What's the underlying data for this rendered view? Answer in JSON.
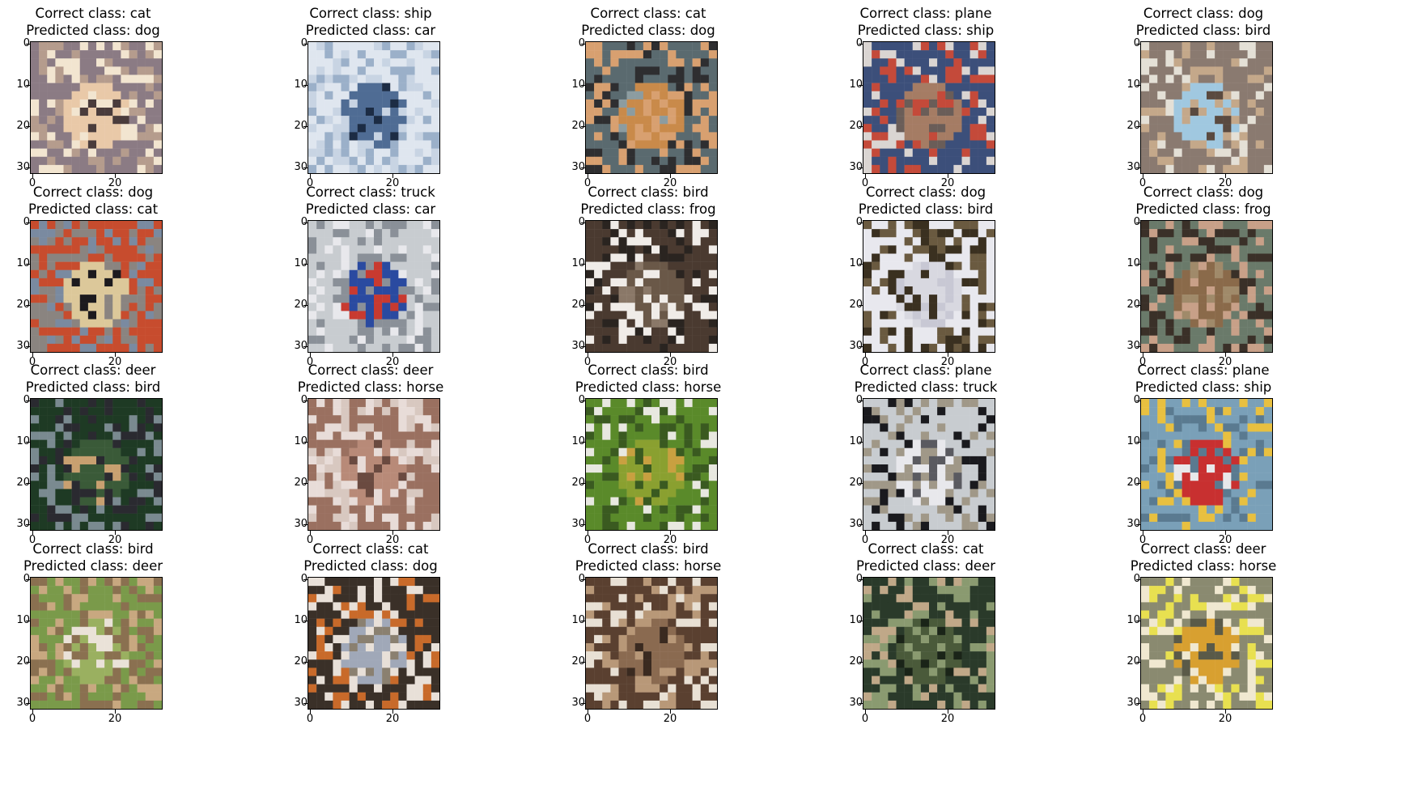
{
  "figure": {
    "panels": [
      {
        "correct": "Correct class: cat",
        "predicted": "Predicted class: dog",
        "image_subject": "cat",
        "palette": [
          "#8b7b84",
          "#e9c9a8",
          "#b59c8d",
          "#4a3c3c",
          "#f2e5d0"
        ]
      },
      {
        "correct": "Correct class: ship",
        "predicted": "Predicted class: car",
        "image_subject": "ship",
        "palette": [
          "#dfe6ef",
          "#4f6c94",
          "#9bb0c9",
          "#1c2c44",
          "#c8d4e3"
        ]
      },
      {
        "correct": "Correct class: cat",
        "predicted": "Predicted class: dog",
        "image_subject": "cat",
        "palette": [
          "#5a6a6f",
          "#c98a4a",
          "#2e2e30",
          "#8c9ca0",
          "#d8a070"
        ]
      },
      {
        "correct": "Correct class: plane",
        "predicted": "Predicted class: ship",
        "image_subject": "plane",
        "palette": [
          "#3c4f7a",
          "#a57c64",
          "#dad5d2",
          "#6a5d58",
          "#c44a3a"
        ]
      },
      {
        "correct": "Correct class: dog",
        "predicted": "Predicted class: bird",
        "image_subject": "dog",
        "palette": [
          "#8a7a70",
          "#a0c8e0",
          "#e4e0d6",
          "#5a4a40",
          "#c4a88a"
        ]
      },
      {
        "correct": "Correct class: dog",
        "predicted": "Predicted class: cat",
        "image_subject": "dog",
        "palette": [
          "#c74c2e",
          "#dcc89a",
          "#7a8aa0",
          "#1c1a1e",
          "#8a8480"
        ]
      },
      {
        "correct": "Correct class: truck",
        "predicted": "Predicted class: car",
        "image_subject": "truck",
        "palette": [
          "#c8ccd0",
          "#2a4aa0",
          "#e8e8ec",
          "#c83a30",
          "#8a9098"
        ]
      },
      {
        "correct": "Correct class: bird",
        "predicted": "Predicted class: frog",
        "image_subject": "bird",
        "palette": [
          "#4a3a30",
          "#6a5848",
          "#2a2420",
          "#8a7868",
          "#f0ece8"
        ]
      },
      {
        "correct": "Correct class: dog",
        "predicted": "Predicted class: bird",
        "image_subject": "dog",
        "palette": [
          "#e8e8ee",
          "#d8d8e0",
          "#6a5a40",
          "#c8c8d4",
          "#3a3020"
        ]
      },
      {
        "correct": "Correct class: dog",
        "predicted": "Predicted class: frog",
        "image_subject": "dog",
        "palette": [
          "#6a7a6a",
          "#8a6a4a",
          "#3a3028",
          "#a08a6a",
          "#c8a088"
        ]
      },
      {
        "correct": "Correct class: deer",
        "predicted": "Predicted class: bird",
        "image_subject": "deer",
        "palette": [
          "#1e3a24",
          "#3a5a38",
          "#7a8a90",
          "#c8a070",
          "#2a2a30"
        ]
      },
      {
        "correct": "Correct class: deer",
        "predicted": "Predicted class: horse",
        "image_subject": "deer",
        "palette": [
          "#9a7060",
          "#b88a78",
          "#d8c8c0",
          "#6a4a40",
          "#e8dcd8"
        ]
      },
      {
        "correct": "Correct class: bird",
        "predicted": "Predicted class: horse",
        "image_subject": "bird",
        "palette": [
          "#5a8a2a",
          "#8aa030",
          "#e8e8e0",
          "#c8a040",
          "#3a5a20"
        ]
      },
      {
        "correct": "Correct class: plane",
        "predicted": "Predicted class: truck",
        "image_subject": "plane",
        "palette": [
          "#c8ccd0",
          "#e8e8ec",
          "#1a1a1e",
          "#5a5a60",
          "#a09888"
        ]
      },
      {
        "correct": "Correct class: plane",
        "predicted": "Predicted class: ship",
        "image_subject": "plane",
        "palette": [
          "#7aa0b8",
          "#c83030",
          "#e8c040",
          "#e8e8ea",
          "#5a7a90"
        ]
      },
      {
        "correct": "Correct class: bird",
        "predicted": "Predicted class: deer",
        "image_subject": "bird",
        "palette": [
          "#7a9a4a",
          "#9ab060",
          "#c8a880",
          "#eae2d8",
          "#8a7050"
        ]
      },
      {
        "correct": "Correct class: cat",
        "predicted": "Predicted class: dog",
        "image_subject": "cat",
        "palette": [
          "#3a3028",
          "#a0a8b8",
          "#c86a2a",
          "#8a8070",
          "#e8e0d8"
        ]
      },
      {
        "correct": "Correct class: bird",
        "predicted": "Predicted class: horse",
        "image_subject": "bird",
        "palette": [
          "#5a4030",
          "#8a6a50",
          "#e8e0d4",
          "#3a2a20",
          "#b89878"
        ]
      },
      {
        "correct": "Correct class: cat",
        "predicted": "Predicted class: deer",
        "image_subject": "cat",
        "palette": [
          "#2a3a2a",
          "#4a5a3a",
          "#c0a888",
          "#1a2418",
          "#8a9a70"
        ]
      },
      {
        "correct": "Correct class: deer",
        "predicted": "Predicted class: horse",
        "image_subject": "deer",
        "palette": [
          "#8a8a70",
          "#d8a030",
          "#e8e050",
          "#5a5a48",
          "#f0e8d0"
        ]
      }
    ],
    "yticks": [
      "0",
      "10",
      "20",
      "30"
    ],
    "xticks": [
      "0",
      "20"
    ]
  }
}
